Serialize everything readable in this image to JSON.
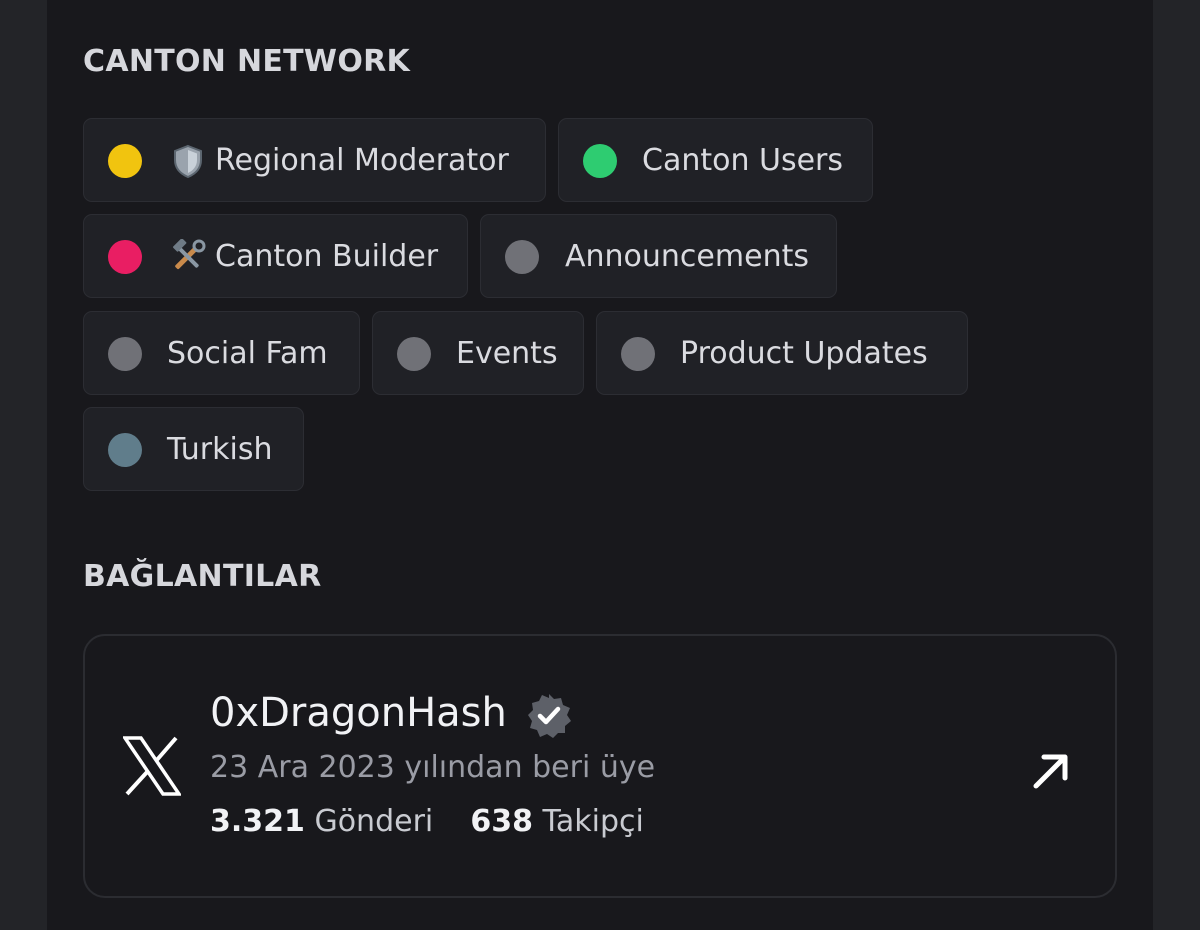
{
  "roles_section": {
    "title": "CANTON NETWORK",
    "roles": [
      {
        "label": "Regional Moderator",
        "color": "#f1c40f",
        "icon": "shield-emoji"
      },
      {
        "label": "Canton Users",
        "color": "#2ecc71"
      },
      {
        "label": "Canton Builder",
        "color": "#e91e63",
        "icon": "hammer-wrench-emoji"
      },
      {
        "label": "Announcements",
        "color": "#707177"
      },
      {
        "label": "Social Fam",
        "color": "#707177"
      },
      {
        "label": "Events",
        "color": "#707177"
      },
      {
        "label": "Product Updates",
        "color": "#707177"
      },
      {
        "label": "Turkish",
        "color": "#607d8b"
      }
    ]
  },
  "connections_section": {
    "title": "BAĞLANTILAR",
    "account": {
      "platform_icon": "x-logo-icon",
      "name": "0xDragonHash",
      "verified_icon": "verified-badge-icon",
      "member_since": "23 Ara 2023 yılından beri üye",
      "posts_count": "3.321",
      "posts_label": "Gönderi",
      "followers_count": "638",
      "followers_label": "Takipçi",
      "open_icon": "external-link-arrow-icon"
    }
  }
}
